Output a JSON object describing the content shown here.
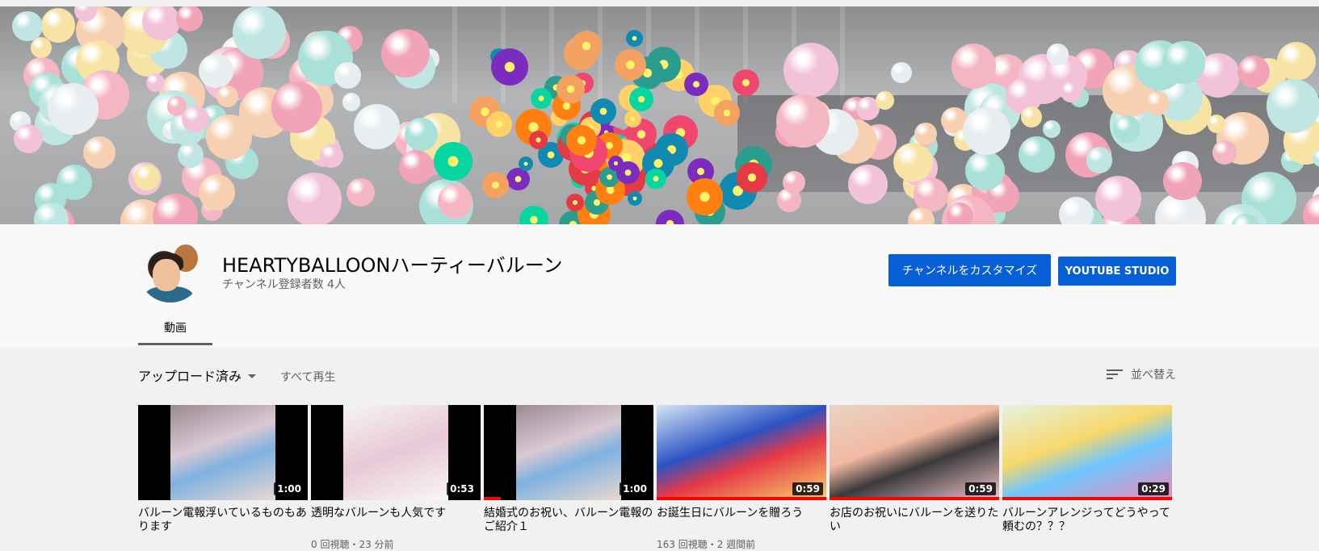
{
  "channel": {
    "name": "HEARTYBALLOONハーティーバルーン",
    "subscribers": "チャンネル登録者数 4人",
    "customize_label": "チャンネルをカスタマイズ",
    "studio_label": "YOUTUBE STUDIO"
  },
  "tabs": [
    {
      "label": "動画",
      "selected": true
    }
  ],
  "toolbar": {
    "filter_label": "アップロード済み",
    "play_all_label": "すべて再生",
    "sort_label": "並べ替え"
  },
  "videos": [
    {
      "title": "バルーン電報浮いているものもあります",
      "duration": "1:00",
      "meta": "",
      "progress": 0
    },
    {
      "title": "透明なバルーンも人気です",
      "duration": "0:53",
      "meta": "0 回視聴・23 分前",
      "progress": 0
    },
    {
      "title": "結婚式のお祝い、バルーン電報のご紹介１",
      "duration": "1:00",
      "meta": "",
      "progress": 0.1
    },
    {
      "title": "お誕生日にバルーンを贈ろう",
      "duration": "0:59",
      "meta": "163 回視聴・2 週間前",
      "progress": 1
    },
    {
      "title": "お店のお祝いにバルーンを送りたい",
      "duration": "0:59",
      "meta": "",
      "progress": 1
    },
    {
      "title": "バルーンアレンジってどうやって頼むの？？？",
      "duration": "0:29",
      "meta": "",
      "progress": 1
    }
  ],
  "colors": {
    "accent": "#065fd4",
    "progress": "#ff0000",
    "page_bg": "#f1f1f1",
    "header_bg": "#f9f9f9"
  },
  "icons": {
    "sort": "sort-icon",
    "dropdown": "caret-down-icon"
  }
}
